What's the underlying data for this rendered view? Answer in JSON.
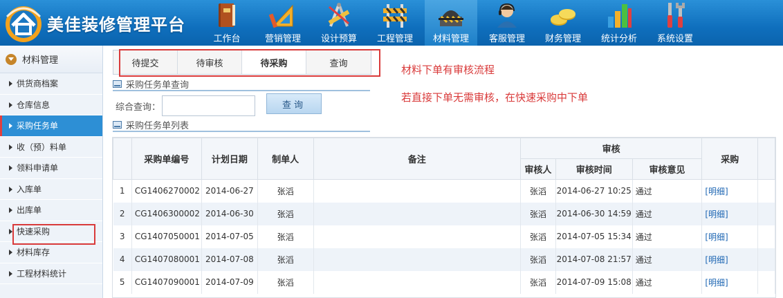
{
  "app": {
    "title": "美佳装修管理平台"
  },
  "nav": [
    {
      "label": "工作台",
      "icon": "book-icon"
    },
    {
      "label": "营销管理",
      "icon": "ruler-triangle-icon"
    },
    {
      "label": "设计预算",
      "icon": "design-tools-icon"
    },
    {
      "label": "工程管理",
      "icon": "barrier-icon"
    },
    {
      "label": "材料管理",
      "icon": "hard-hat-icon",
      "active": true
    },
    {
      "label": "客服管理",
      "icon": "support-agent-icon"
    },
    {
      "label": "财务管理",
      "icon": "coins-icon"
    },
    {
      "label": "统计分析",
      "icon": "bar-chart-icon"
    },
    {
      "label": "系统设置",
      "icon": "tools-icon"
    }
  ],
  "sidebar": {
    "title": "材料管理",
    "items": [
      {
        "label": "供货商档案"
      },
      {
        "label": "仓库信息"
      },
      {
        "label": "采购任务单",
        "active": true
      },
      {
        "label": "收（预）料单"
      },
      {
        "label": "领料申请单"
      },
      {
        "label": "入库单"
      },
      {
        "label": "出库单"
      },
      {
        "label": "快速采购"
      },
      {
        "label": "材料库存"
      },
      {
        "label": "工程材料统计"
      }
    ]
  },
  "tabs": [
    {
      "label": "待提交"
    },
    {
      "label": "待审核"
    },
    {
      "label": "待采购",
      "active": true
    },
    {
      "label": "查询"
    }
  ],
  "notes": {
    "line1": "材料下单有审核流程",
    "line2": "若直接下单无需审核，在快速采购中下单"
  },
  "query_section": {
    "title": "采购任务单查询",
    "label": "综合查询：",
    "input_value": "",
    "button": "查询"
  },
  "list_section": {
    "title": "采购任务单列表"
  },
  "table": {
    "headers": {
      "order_no": "采购单编号",
      "plan_date": "计划日期",
      "creator": "制单人",
      "remark": "备注",
      "review_group": "审核",
      "reviewer": "审核人",
      "review_time": "审核时间",
      "review_opinion": "审核意见",
      "purchase": "采购"
    },
    "rows": [
      {
        "idx": "1",
        "order_no": "CG1406270002",
        "plan_date": "2014-06-27",
        "creator": "张滔",
        "remark": "",
        "reviewer": "张滔",
        "review_time": "2014-06-27 10:25",
        "review_opinion": "通过",
        "purchase": "[明细]"
      },
      {
        "idx": "2",
        "order_no": "CG1406300002",
        "plan_date": "2014-06-30",
        "creator": "张滔",
        "remark": "",
        "reviewer": "张滔",
        "review_time": "2014-06-30 14:59",
        "review_opinion": "通过",
        "purchase": "[明细]"
      },
      {
        "idx": "3",
        "order_no": "CG1407050001",
        "plan_date": "2014-07-05",
        "creator": "张滔",
        "remark": "",
        "reviewer": "张滔",
        "review_time": "2014-07-05 15:34",
        "review_opinion": "通过",
        "purchase": "[明细]"
      },
      {
        "idx": "4",
        "order_no": "CG1407080001",
        "plan_date": "2014-07-08",
        "creator": "张滔",
        "remark": "",
        "reviewer": "张滔",
        "review_time": "2014-07-08 21:57",
        "review_opinion": "通过",
        "purchase": "[明细]"
      },
      {
        "idx": "5",
        "order_no": "CG1407090001",
        "plan_date": "2014-07-09",
        "creator": "张滔",
        "remark": "",
        "reviewer": "张滔",
        "review_time": "2014-07-09 15:08",
        "review_opinion": "通过",
        "purchase": "[明细]"
      }
    ]
  },
  "colors": {
    "header_blue": "#0f6fbd",
    "active_blue": "#2d8fd5",
    "highlight_red": "#d93a3a",
    "link_blue": "#1d66b3"
  }
}
